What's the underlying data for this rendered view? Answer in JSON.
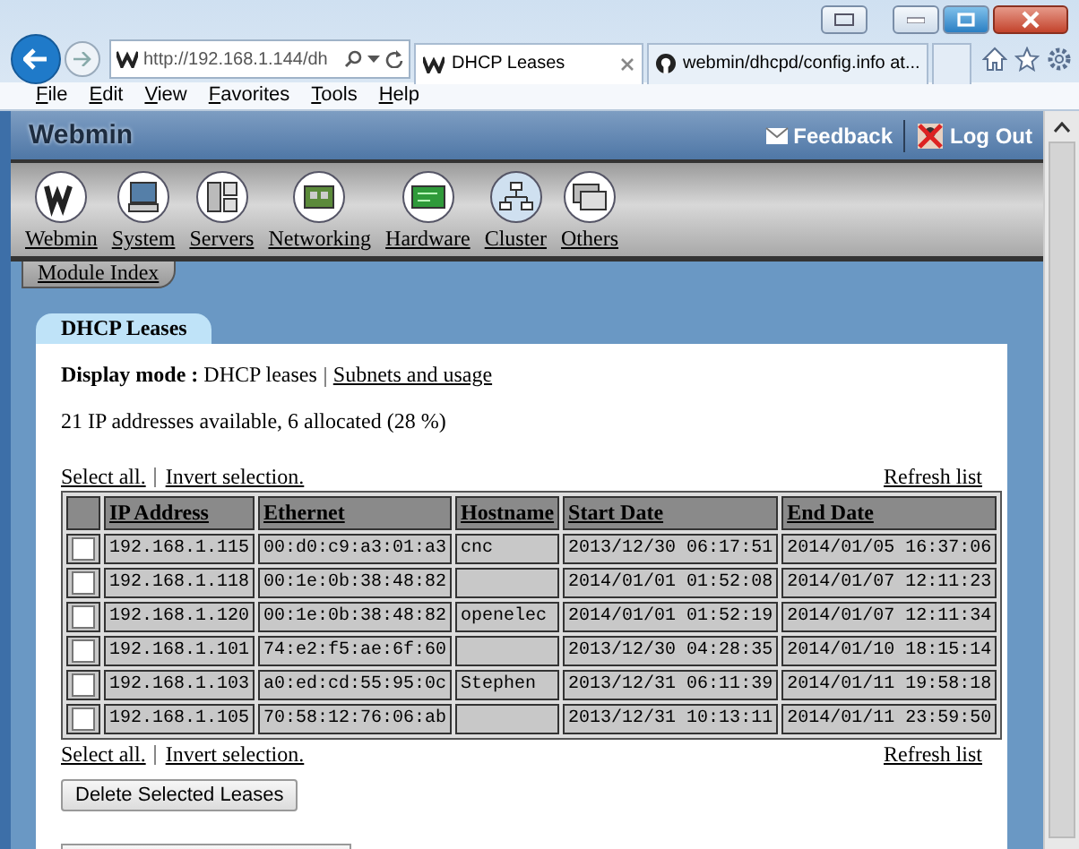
{
  "browser": {
    "address": "http://192.168.1.144/dh",
    "tabs": [
      {
        "label": "DHCP Leases",
        "selected": true
      },
      {
        "label": "webmin/dhcpd/config.info at...",
        "selected": false
      }
    ],
    "menu": [
      "File",
      "Edit",
      "View",
      "Favorites",
      "Tools",
      "Help"
    ]
  },
  "header": {
    "logo": "Webmin",
    "feedback": "Feedback",
    "logout": "Log Out"
  },
  "categories": [
    "Webmin",
    "System",
    "Servers",
    "Networking",
    "Hardware",
    "Cluster",
    "Others"
  ],
  "module_index": "Module Index",
  "panel": {
    "tab": "DHCP Leases",
    "display_mode_label": "Display mode :",
    "display_mode_current": "DHCP leases",
    "display_mode_link": "Subnets and usage",
    "summary": "21 IP addresses available, 6 allocated (28 %)",
    "top_links": {
      "select_all": "Select all.",
      "invert": "Invert selection.",
      "refresh": "Refresh list"
    },
    "columns": [
      "IP Address",
      "Ethernet",
      "Hostname",
      "Start Date",
      "End Date"
    ],
    "rows": [
      {
        "checked": false,
        "cells": [
          "192.168.1.115",
          "00:d0:c9:a3:01:a3",
          "cnc",
          "2013/12/30 06:17:51",
          "2014/01/05 16:37:06"
        ]
      },
      {
        "checked": false,
        "cells": [
          "192.168.1.118",
          "00:1e:0b:38:48:82",
          "",
          "2014/01/01 01:52:08",
          "2014/01/07 12:11:23"
        ]
      },
      {
        "checked": false,
        "cells": [
          "192.168.1.120",
          "00:1e:0b:38:48:82",
          "openelec",
          "2014/01/01 01:52:19",
          "2014/01/07 12:11:34"
        ]
      },
      {
        "checked": false,
        "cells": [
          "192.168.1.101",
          "74:e2:f5:ae:6f:60",
          "",
          "2013/12/30 04:28:35",
          "2014/01/10 18:15:14"
        ]
      },
      {
        "checked": false,
        "cells": [
          "192.168.1.103",
          "a0:ed:cd:55:95:0c",
          "Stephen",
          "2013/12/31 06:11:39",
          "2014/01/11 19:58:18"
        ]
      },
      {
        "checked": false,
        "cells": [
          "192.168.1.105",
          "70:58:12:76:06:ab",
          "",
          "2013/12/31 10:13:11",
          "2014/01/11 23:59:50"
        ]
      }
    ],
    "bottom_links": {
      "select_all": "Select all.",
      "invert": "Invert selection.",
      "refresh": "Refresh list"
    },
    "delete_button": "Delete Selected Leases"
  }
}
